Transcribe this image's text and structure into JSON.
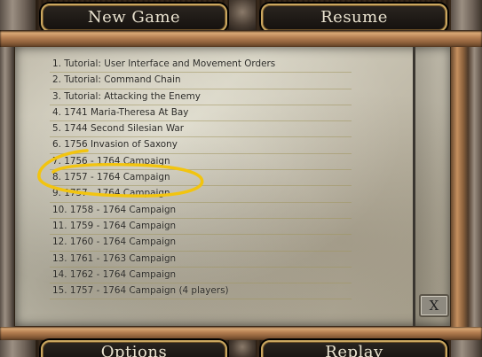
{
  "menu": {
    "new_game": "New Game",
    "resume": "Resume",
    "options": "Options",
    "replay": "Replay"
  },
  "close_label": "X",
  "scenarios": [
    "1. Tutorial: User Interface and Movement Orders",
    "2. Tutorial: Command Chain",
    "3. Tutorial: Attacking the Enemy",
    "4. 1741 Maria-Theresa At Bay",
    "5. 1744 Second Silesian War",
    "6. 1756 Invasion of Saxony",
    "7. 1756 - 1764 Campaign",
    "8. 1757 - 1764 Campaign",
    "9. 1757 - 1764 Campaign",
    "10. 1758 - 1764 Campaign",
    "11. 1759 - 1764 Campaign",
    "12. 1760 - 1764 Campaign",
    "13. 1761 - 1763 Campaign",
    "14. 1762 - 1764 Campaign",
    "15. 1757 - 1764 Campaign (4 players)"
  ],
  "colors": {
    "annotation": "#f2c40f",
    "button_border": "#caa760",
    "button_text": "#e9e2cf"
  }
}
